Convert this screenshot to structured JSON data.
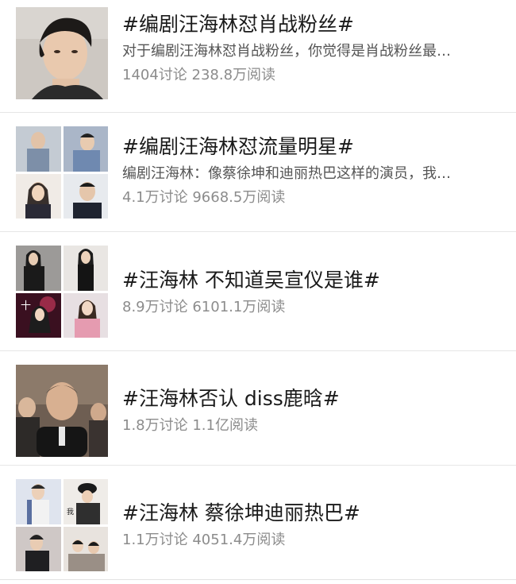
{
  "topics": [
    {
      "title": "#编剧汪海林怼肖战粉丝#",
      "desc": "对于编剧汪海林怼肖战粉丝，你觉得是肖战粉丝最…",
      "stats": "1404讨论 238.8万阅读",
      "thumb": "single-portrait"
    },
    {
      "title": "#编剧汪海林怼流量明星#",
      "desc": "编剧汪海林：像蔡徐坤和迪丽热巴这样的演员，我…",
      "stats": "4.1万讨论 9668.5万阅读",
      "thumb": "grid"
    },
    {
      "title": "#汪海林 不知道吴宣仪是谁#",
      "desc": "",
      "stats": "8.9万讨论 6101.1万阅读",
      "thumb": "grid"
    },
    {
      "title": "#汪海林否认 diss鹿晗#",
      "desc": "",
      "stats": "1.8万讨论 1.1亿阅读",
      "thumb": "single-photo"
    },
    {
      "title": "#汪海林 蔡徐坤迪丽热巴#",
      "desc": "",
      "stats": "1.1万讨论 4051.4万阅读",
      "thumb": "grid"
    }
  ],
  "colors": {
    "title": "#1a1a1a",
    "desc": "#555555",
    "stats": "#8c8c8c",
    "divider": "#e6e6e6"
  }
}
